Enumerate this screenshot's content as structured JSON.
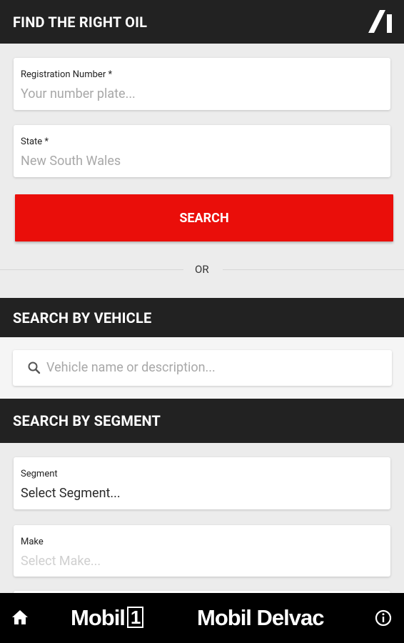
{
  "header": {
    "title": "FIND THE RIGHT OIL",
    "logo_icon": "brand-a-logo-icon"
  },
  "registration": {
    "label": "Registration Number *",
    "placeholder": "Your number plate..."
  },
  "state": {
    "label": "State *",
    "value": "New South Wales"
  },
  "search_button": {
    "label": "SEARCH"
  },
  "divider": {
    "label": "OR"
  },
  "vehicle_section": {
    "title": "SEARCH BY VEHICLE",
    "search_placeholder": "Vehicle name or description...",
    "search_icon": "search-icon"
  },
  "segment_section": {
    "title": "SEARCH BY SEGMENT",
    "segment": {
      "label": "Segment",
      "value": "Select Segment..."
    },
    "make": {
      "label": "Make",
      "value": "Select Make..."
    }
  },
  "footer": {
    "home_icon": "home-icon",
    "brand1_text": "Mobil",
    "brand1_suffix": "1",
    "brand2_text": "Mobil Delvac",
    "info_icon": "info-icon"
  },
  "colors": {
    "header_bg": "#222222",
    "accent_red": "#ea0e0a",
    "page_bg": "#ececec",
    "footer_bg": "#000000"
  }
}
